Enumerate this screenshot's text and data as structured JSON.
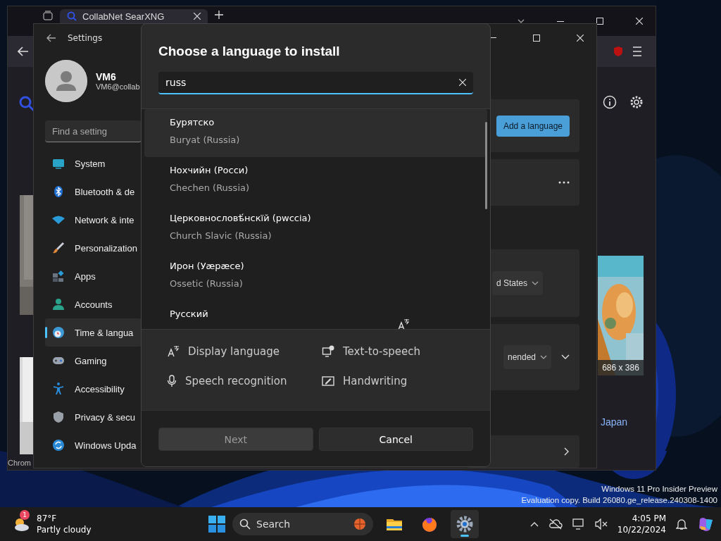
{
  "browser": {
    "tab_title": "CollabNet SearXNG",
    "image_caption": "686 x 386",
    "link": "Japan",
    "edge_text": "Chrom"
  },
  "settings": {
    "title": "Settings",
    "user": {
      "name": "VM6",
      "email": "VM6@collab"
    },
    "search": {
      "placeholder": "Find a setting"
    },
    "nav": [
      {
        "label": "System",
        "selected": false
      },
      {
        "label": "Bluetooth & de",
        "selected": false
      },
      {
        "label": "Network & inte",
        "selected": false
      },
      {
        "label": "Personalization",
        "selected": false
      },
      {
        "label": "Apps",
        "selected": false
      },
      {
        "label": "Accounts",
        "selected": false
      },
      {
        "label": "Time & langua",
        "selected": true
      },
      {
        "label": "Gaming",
        "selected": false
      },
      {
        "label": "Accessibility",
        "selected": false
      },
      {
        "label": "Privacy & secu",
        "selected": false
      },
      {
        "label": "Windows Upda",
        "selected": false
      }
    ],
    "add_button": "Add a language",
    "region_value": "d States",
    "format_value": "nended"
  },
  "dialog": {
    "title": "Choose a language to install",
    "search": {
      "value": "russ"
    },
    "languages": [
      {
        "native": "Бурятско",
        "name": "Buryat (Russia)",
        "selected": true,
        "display_language": false
      },
      {
        "native": "Нохчийн (Росси)",
        "name": "Chechen (Russia)",
        "selected": false,
        "display_language": false
      },
      {
        "native": "Церковнословѣ́нскїй (рwссіа)",
        "name": "Church Slavic (Russia)",
        "selected": false,
        "display_language": false
      },
      {
        "native": "Ирон (Уæрæсе)",
        "name": "Ossetic (Russia)",
        "selected": false,
        "display_language": false
      },
      {
        "native": "Русский",
        "selected": false,
        "display_language": true
      }
    ],
    "features": [
      {
        "kind": "display",
        "label": "Display language"
      },
      {
        "kind": "tts",
        "label": "Text-to-speech"
      },
      {
        "kind": "speech",
        "label": "Speech recognition"
      },
      {
        "kind": "handwriting",
        "label": "Handwriting"
      }
    ],
    "buttons": [
      {
        "label": "Next",
        "disabled": true
      },
      {
        "label": "Cancel",
        "disabled": false
      }
    ]
  },
  "desktop": {
    "watermark": [
      "Windows 11 Pro Insider Preview",
      "Evaluation copy. Build 26080.ge_release.240308-1400"
    ]
  },
  "taskbar": {
    "weather": {
      "badge": "1",
      "temp": "87°F",
      "condition": "Partly cloudy"
    },
    "search": {
      "placeholder": "Search"
    },
    "apps": [
      {
        "kind": "explorer",
        "active": false
      },
      {
        "kind": "firefox",
        "active": false
      },
      {
        "kind": "settings",
        "active": true
      }
    ],
    "clock": {
      "time": "4:05 PM",
      "date": "10/22/2024"
    }
  }
}
